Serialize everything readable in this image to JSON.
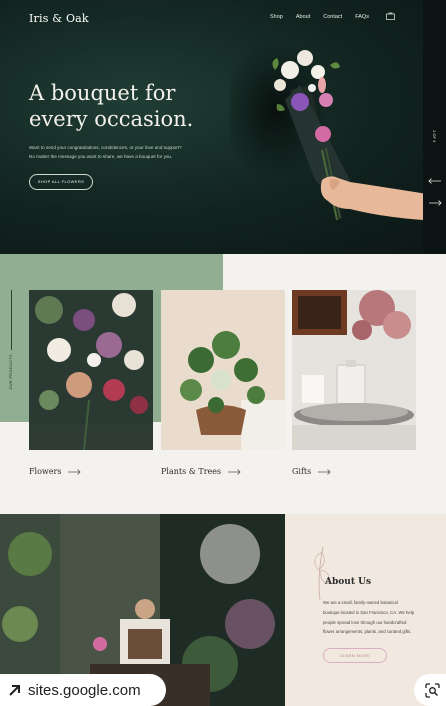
{
  "brand": {
    "logo": "Iris & Oak"
  },
  "nav": {
    "items": [
      "Shop",
      "About",
      "Contact",
      "FAQs"
    ],
    "bag_icon": "shopping-bag-icon"
  },
  "hero": {
    "title_line1": "A bouquet for",
    "title_line2": "every occasion.",
    "text_line1": "Want to send your congratulations, condolences, or your love and support?",
    "text_line2": "No matter the message you want to share, we have a bouquet for you.",
    "cta": "SHOP ALL FLOWERS",
    "pager": "1 OF 4"
  },
  "products": {
    "section_label": "OUR PRODUCTS",
    "cards": [
      {
        "label": "Flowers"
      },
      {
        "label": "Plants & Trees"
      },
      {
        "label": "Gifts"
      }
    ]
  },
  "about": {
    "title": "About Us",
    "text_line1": "We are a small, family-owned botanical",
    "text_line2": "boutique located in San Francisco, CA. We help",
    "text_line3": "people spread love through our handcrafted",
    "text_line4": "flower arrangements, plants, and curated gifts.",
    "cta": "LEARN MORE"
  },
  "overlay": {
    "source": "sites.google.com",
    "source_icon": "external-link-icon",
    "lens_icon": "lens-search-icon"
  },
  "colors": {
    "hero_bg": "#12231f",
    "sage": "#8fae92",
    "cream": "#f1e9df",
    "accent_pink": "#d9aec3"
  }
}
